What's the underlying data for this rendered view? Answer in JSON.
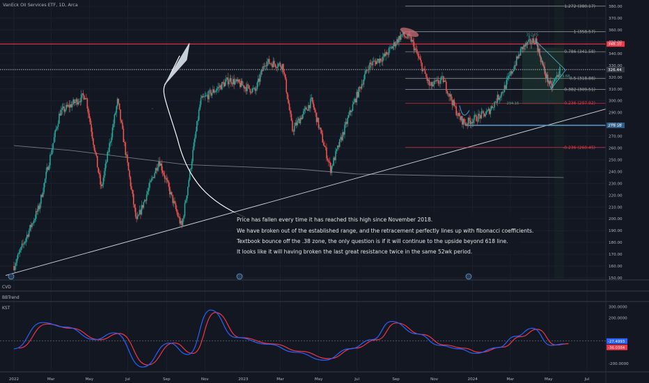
{
  "title": "VanEck Oil Services ETF, 1D, Arca",
  "panels": {
    "cvd": "CVD",
    "bbtrend": "BBTrend",
    "kst": "KST"
  },
  "annotations": [
    "Price has fallen every time it has reached this high since November 2018.",
    "We have broken out of the established range, and the retracement perfectly lines up with fibonacci coefficients.",
    "Textbook bounce off the .38 zone, the only question is if it will continue to the upside beyond 618 line.",
    "It looks like it will having broken the last great resistance twice in the same 52wk period."
  ],
  "colors": {
    "background": "#131722",
    "up": "#26a69a",
    "down": "#ef5350",
    "resistance": "#f23645",
    "support": "#5b9cc4",
    "fib": "#5e8a78",
    "kst": "#2962ff",
    "kst_signal": "#f23645"
  },
  "chart_data": {
    "type": "candlestick",
    "x_ticks": [
      "2022",
      "Mar",
      "May",
      "Jul",
      "Sep",
      "Nov",
      "2023",
      "Mar",
      "May",
      "Jul",
      "Sep",
      "Nov",
      "2024",
      "Mar",
      "May",
      "Jul"
    ],
    "y_ticks": [
      "150.00",
      "160.00",
      "170.00",
      "180.00",
      "190.00",
      "200.00",
      "210.00",
      "220.00",
      "230.00",
      "240.00",
      "250.00",
      "260.00",
      "270.00",
      "280.00",
      "290.00",
      "300.00",
      "310.00",
      "320.00",
      "330.00",
      "340.00",
      "350.00",
      "360.00",
      "370.00",
      "380.00"
    ],
    "ylim": [
      150,
      383
    ],
    "price_key_points": [
      {
        "x": "2022-01-01",
        "y": 160
      },
      {
        "x": "2022-02-10",
        "y": 210
      },
      {
        "x": "2022-03-15",
        "y": 290
      },
      {
        "x": "2022-04-25",
        "y": 305
      },
      {
        "x": "2022-05-20",
        "y": 225
      },
      {
        "x": "2022-06-15",
        "y": 300
      },
      {
        "x": "2022-07-15",
        "y": 197
      },
      {
        "x": "2022-08-20",
        "y": 250
      },
      {
        "x": "2022-09-25",
        "y": 193
      },
      {
        "x": "2022-10-25",
        "y": 300
      },
      {
        "x": "2022-12-10",
        "y": 318
      },
      {
        "x": "2023-01-20",
        "y": 308
      },
      {
        "x": "2023-02-05",
        "y": 333
      },
      {
        "x": "2023-03-05",
        "y": 330
      },
      {
        "x": "2023-03-20",
        "y": 275
      },
      {
        "x": "2023-04-20",
        "y": 300
      },
      {
        "x": "2023-05-20",
        "y": 242
      },
      {
        "x": "2023-06-20",
        "y": 290
      },
      {
        "x": "2023-07-20",
        "y": 330
      },
      {
        "x": "2023-08-15",
        "y": 338
      },
      {
        "x": "2023-09-10",
        "y": 356
      },
      {
        "x": "2023-09-25",
        "y": 352
      },
      {
        "x": "2023-10-25",
        "y": 312
      },
      {
        "x": "2023-11-15",
        "y": 318
      },
      {
        "x": "2023-12-10",
        "y": 286
      },
      {
        "x": "2023-12-20",
        "y": 281
      },
      {
        "x": "2024-01-25",
        "y": 290
      },
      {
        "x": "2024-02-20",
        "y": 310
      },
      {
        "x": "2024-03-20",
        "y": 345
      },
      {
        "x": "2024-04-10",
        "y": 352
      },
      {
        "x": "2024-04-25",
        "y": 323
      },
      {
        "x": "2024-05-05",
        "y": 311
      },
      {
        "x": "2024-05-20",
        "y": 327
      }
    ],
    "horizontal_levels": [
      {
        "label": "348.10",
        "y": 348.1,
        "style": "resistance"
      },
      {
        "label": "326.44",
        "y": 326.4,
        "style": "dotted"
      },
      {
        "label": "279.18",
        "y": 279.18,
        "style": "support"
      }
    ],
    "fibonacci": [
      {
        "label": "1.272 (380.17)",
        "y": 380.17
      },
      {
        "label": "1 (358.57)",
        "y": 358.57
      },
      {
        "label": "0.786 (341.58)",
        "y": 341.58
      },
      {
        "label": "0.5 (318.88)",
        "y": 318.88
      },
      {
        "label": "0.382 (309.51)",
        "y": 309.51
      },
      {
        "label": "0.236 (297.92)",
        "y": 297.92
      },
      {
        "label": "-0.236 (260.45)",
        "y": 260.45
      }
    ],
    "price_marks": [
      {
        "label": "352.05",
        "x": "2024-04-05",
        "y": 355
      },
      {
        "label": "294.16",
        "x": "2024-03-05",
        "y": 297
      },
      {
        "label": "319.68",
        "x": "2024-05-25",
        "y": 320
      }
    ],
    "moving_average": [
      {
        "x": "2022-01-01",
        "y": 262
      },
      {
        "x": "2022-04-01",
        "y": 258
      },
      {
        "x": "2022-07-01",
        "y": 252
      },
      {
        "x": "2022-10-01",
        "y": 246
      },
      {
        "x": "2023-01-01",
        "y": 244
      },
      {
        "x": "2023-04-01",
        "y": 242
      },
      {
        "x": "2023-07-01",
        "y": 238
      },
      {
        "x": "2023-10-01",
        "y": 237
      },
      {
        "x": "2024-01-01",
        "y": 236
      },
      {
        "x": "2024-05-25",
        "y": 235
      }
    ],
    "kst": {
      "y_ticks": [
        "300.0000",
        "200.0000",
        "0.0000",
        "-200.0000"
      ],
      "ylim": [
        -260,
        320
      ],
      "last_values": [
        "-27.4993",
        "-36.0384"
      ],
      "kst": [
        {
          "x": "2022-01-01",
          "y": -70
        },
        {
          "x": "2022-02-15",
          "y": 160
        },
        {
          "x": "2022-03-25",
          "y": 120
        },
        {
          "x": "2022-05-10",
          "y": 10
        },
        {
          "x": "2022-06-10",
          "y": 70
        },
        {
          "x": "2022-07-25",
          "y": -230
        },
        {
          "x": "2022-09-05",
          "y": -20
        },
        {
          "x": "2022-10-05",
          "y": -120
        },
        {
          "x": "2022-11-10",
          "y": 270
        },
        {
          "x": "2022-12-20",
          "y": 30
        },
        {
          "x": "2023-02-10",
          "y": -30
        },
        {
          "x": "2023-03-25",
          "y": -100
        },
        {
          "x": "2023-05-10",
          "y": -170
        },
        {
          "x": "2023-06-20",
          "y": -70
        },
        {
          "x": "2023-07-25",
          "y": 10
        },
        {
          "x": "2023-08-25",
          "y": 170
        },
        {
          "x": "2023-10-05",
          "y": 60
        },
        {
          "x": "2023-11-10",
          "y": -40
        },
        {
          "x": "2023-12-10",
          "y": -70
        },
        {
          "x": "2024-01-05",
          "y": -110
        },
        {
          "x": "2024-02-10",
          "y": -60
        },
        {
          "x": "2024-03-10",
          "y": 40
        },
        {
          "x": "2024-04-05",
          "y": 110
        },
        {
          "x": "2024-05-05",
          "y": -40
        },
        {
          "x": "2024-05-25",
          "y": -27
        }
      ]
    }
  }
}
